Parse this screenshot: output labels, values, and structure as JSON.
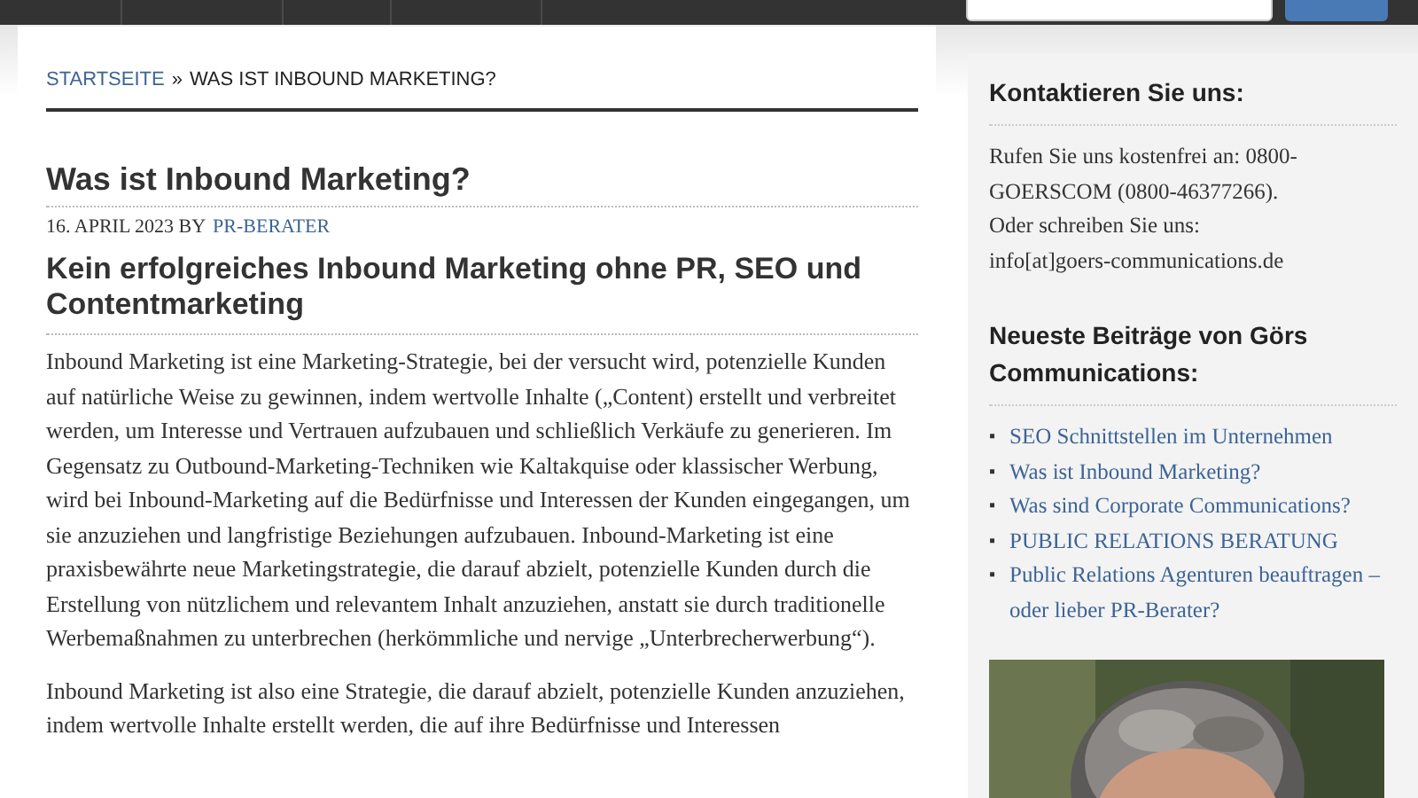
{
  "breadcrumb": {
    "home": "STARTSEITE",
    "separator": "»",
    "current": "WAS IST INBOUND MARKETING?"
  },
  "article": {
    "title": "Was ist Inbound Marketing?",
    "date": "16. APRIL 2023 BY",
    "author": "PR-BERATER",
    "subtitle": "Kein erfolgreiches Inbound Marketing ohne PR, SEO und Contentmarketing",
    "paragraphs": [
      "Inbound Marketing ist eine Marketing-Strategie, bei der versucht wird, potenzielle Kunden auf natürliche Weise zu gewinnen, indem wertvolle Inhalte  („Content) erstellt und verbreitet werden, um Interesse und Vertrauen aufzubauen und schließlich Verkäufe zu generieren. Im Gegensatz zu Outbound-Marketing-Techniken wie Kaltakquise oder klassischer Werbung, wird bei Inbound-Marketing auf die Bedürfnisse und Interessen der Kunden eingegangen, um sie anzuziehen und langfristige Beziehungen aufzubauen. Inbound-Marketing ist eine praxisbewährte neue Marketingstrategie, die darauf abzielt, potenzielle Kunden durch die Erstellung von nützlichem und relevantem Inhalt anzuziehen, anstatt sie durch traditionelle Werbemaßnahmen zu unterbrechen (herkömmliche und nervige „Unterbrecherwerbung“).",
      "Inbound Marketing ist also eine Strategie, die darauf abzielt, potenzielle Kunden anzuziehen, indem wertvolle Inhalte erstellt werden, die auf ihre Bedürfnisse und Interessen"
    ]
  },
  "sidebar": {
    "contact": {
      "title": "Kontaktieren Sie uns:",
      "lines": [
        "Rufen Sie uns kostenfrei an: 0800-GOERSCOM (0800-46377266).",
        "Oder schreiben Sie uns:",
        "info[at]goers-communications.de"
      ]
    },
    "recent": {
      "title": "Neueste Beiträge von Görs Communications:",
      "bullet": "▪",
      "items": [
        "SEO Schnittstellen im Unternehmen",
        "Was ist Inbound Marketing?",
        "Was sind Corporate Communications?",
        "PUBLIC RELATIONS BERATUNG",
        "Public Relations Agenturen beauftragen – oder lieber PR-Berater?"
      ]
    }
  }
}
